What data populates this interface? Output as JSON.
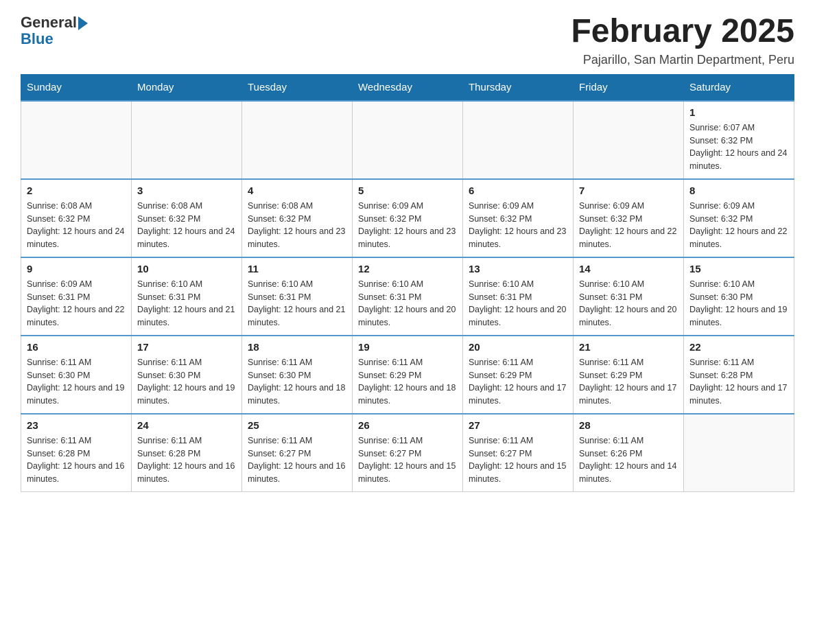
{
  "header": {
    "logo_general": "General",
    "logo_blue": "Blue",
    "month_title": "February 2025",
    "location": "Pajarillo, San Martin Department, Peru"
  },
  "days_of_week": [
    "Sunday",
    "Monday",
    "Tuesday",
    "Wednesday",
    "Thursday",
    "Friday",
    "Saturday"
  ],
  "weeks": [
    [
      {
        "day": "",
        "info": ""
      },
      {
        "day": "",
        "info": ""
      },
      {
        "day": "",
        "info": ""
      },
      {
        "day": "",
        "info": ""
      },
      {
        "day": "",
        "info": ""
      },
      {
        "day": "",
        "info": ""
      },
      {
        "day": "1",
        "info": "Sunrise: 6:07 AM\nSunset: 6:32 PM\nDaylight: 12 hours and 24 minutes."
      }
    ],
    [
      {
        "day": "2",
        "info": "Sunrise: 6:08 AM\nSunset: 6:32 PM\nDaylight: 12 hours and 24 minutes."
      },
      {
        "day": "3",
        "info": "Sunrise: 6:08 AM\nSunset: 6:32 PM\nDaylight: 12 hours and 24 minutes."
      },
      {
        "day": "4",
        "info": "Sunrise: 6:08 AM\nSunset: 6:32 PM\nDaylight: 12 hours and 23 minutes."
      },
      {
        "day": "5",
        "info": "Sunrise: 6:09 AM\nSunset: 6:32 PM\nDaylight: 12 hours and 23 minutes."
      },
      {
        "day": "6",
        "info": "Sunrise: 6:09 AM\nSunset: 6:32 PM\nDaylight: 12 hours and 23 minutes."
      },
      {
        "day": "7",
        "info": "Sunrise: 6:09 AM\nSunset: 6:32 PM\nDaylight: 12 hours and 22 minutes."
      },
      {
        "day": "8",
        "info": "Sunrise: 6:09 AM\nSunset: 6:32 PM\nDaylight: 12 hours and 22 minutes."
      }
    ],
    [
      {
        "day": "9",
        "info": "Sunrise: 6:09 AM\nSunset: 6:31 PM\nDaylight: 12 hours and 22 minutes."
      },
      {
        "day": "10",
        "info": "Sunrise: 6:10 AM\nSunset: 6:31 PM\nDaylight: 12 hours and 21 minutes."
      },
      {
        "day": "11",
        "info": "Sunrise: 6:10 AM\nSunset: 6:31 PM\nDaylight: 12 hours and 21 minutes."
      },
      {
        "day": "12",
        "info": "Sunrise: 6:10 AM\nSunset: 6:31 PM\nDaylight: 12 hours and 20 minutes."
      },
      {
        "day": "13",
        "info": "Sunrise: 6:10 AM\nSunset: 6:31 PM\nDaylight: 12 hours and 20 minutes."
      },
      {
        "day": "14",
        "info": "Sunrise: 6:10 AM\nSunset: 6:31 PM\nDaylight: 12 hours and 20 minutes."
      },
      {
        "day": "15",
        "info": "Sunrise: 6:10 AM\nSunset: 6:30 PM\nDaylight: 12 hours and 19 minutes."
      }
    ],
    [
      {
        "day": "16",
        "info": "Sunrise: 6:11 AM\nSunset: 6:30 PM\nDaylight: 12 hours and 19 minutes."
      },
      {
        "day": "17",
        "info": "Sunrise: 6:11 AM\nSunset: 6:30 PM\nDaylight: 12 hours and 19 minutes."
      },
      {
        "day": "18",
        "info": "Sunrise: 6:11 AM\nSunset: 6:30 PM\nDaylight: 12 hours and 18 minutes."
      },
      {
        "day": "19",
        "info": "Sunrise: 6:11 AM\nSunset: 6:29 PM\nDaylight: 12 hours and 18 minutes."
      },
      {
        "day": "20",
        "info": "Sunrise: 6:11 AM\nSunset: 6:29 PM\nDaylight: 12 hours and 17 minutes."
      },
      {
        "day": "21",
        "info": "Sunrise: 6:11 AM\nSunset: 6:29 PM\nDaylight: 12 hours and 17 minutes."
      },
      {
        "day": "22",
        "info": "Sunrise: 6:11 AM\nSunset: 6:28 PM\nDaylight: 12 hours and 17 minutes."
      }
    ],
    [
      {
        "day": "23",
        "info": "Sunrise: 6:11 AM\nSunset: 6:28 PM\nDaylight: 12 hours and 16 minutes."
      },
      {
        "day": "24",
        "info": "Sunrise: 6:11 AM\nSunset: 6:28 PM\nDaylight: 12 hours and 16 minutes."
      },
      {
        "day": "25",
        "info": "Sunrise: 6:11 AM\nSunset: 6:27 PM\nDaylight: 12 hours and 16 minutes."
      },
      {
        "day": "26",
        "info": "Sunrise: 6:11 AM\nSunset: 6:27 PM\nDaylight: 12 hours and 15 minutes."
      },
      {
        "day": "27",
        "info": "Sunrise: 6:11 AM\nSunset: 6:27 PM\nDaylight: 12 hours and 15 minutes."
      },
      {
        "day": "28",
        "info": "Sunrise: 6:11 AM\nSunset: 6:26 PM\nDaylight: 12 hours and 14 minutes."
      },
      {
        "day": "",
        "info": ""
      }
    ]
  ]
}
